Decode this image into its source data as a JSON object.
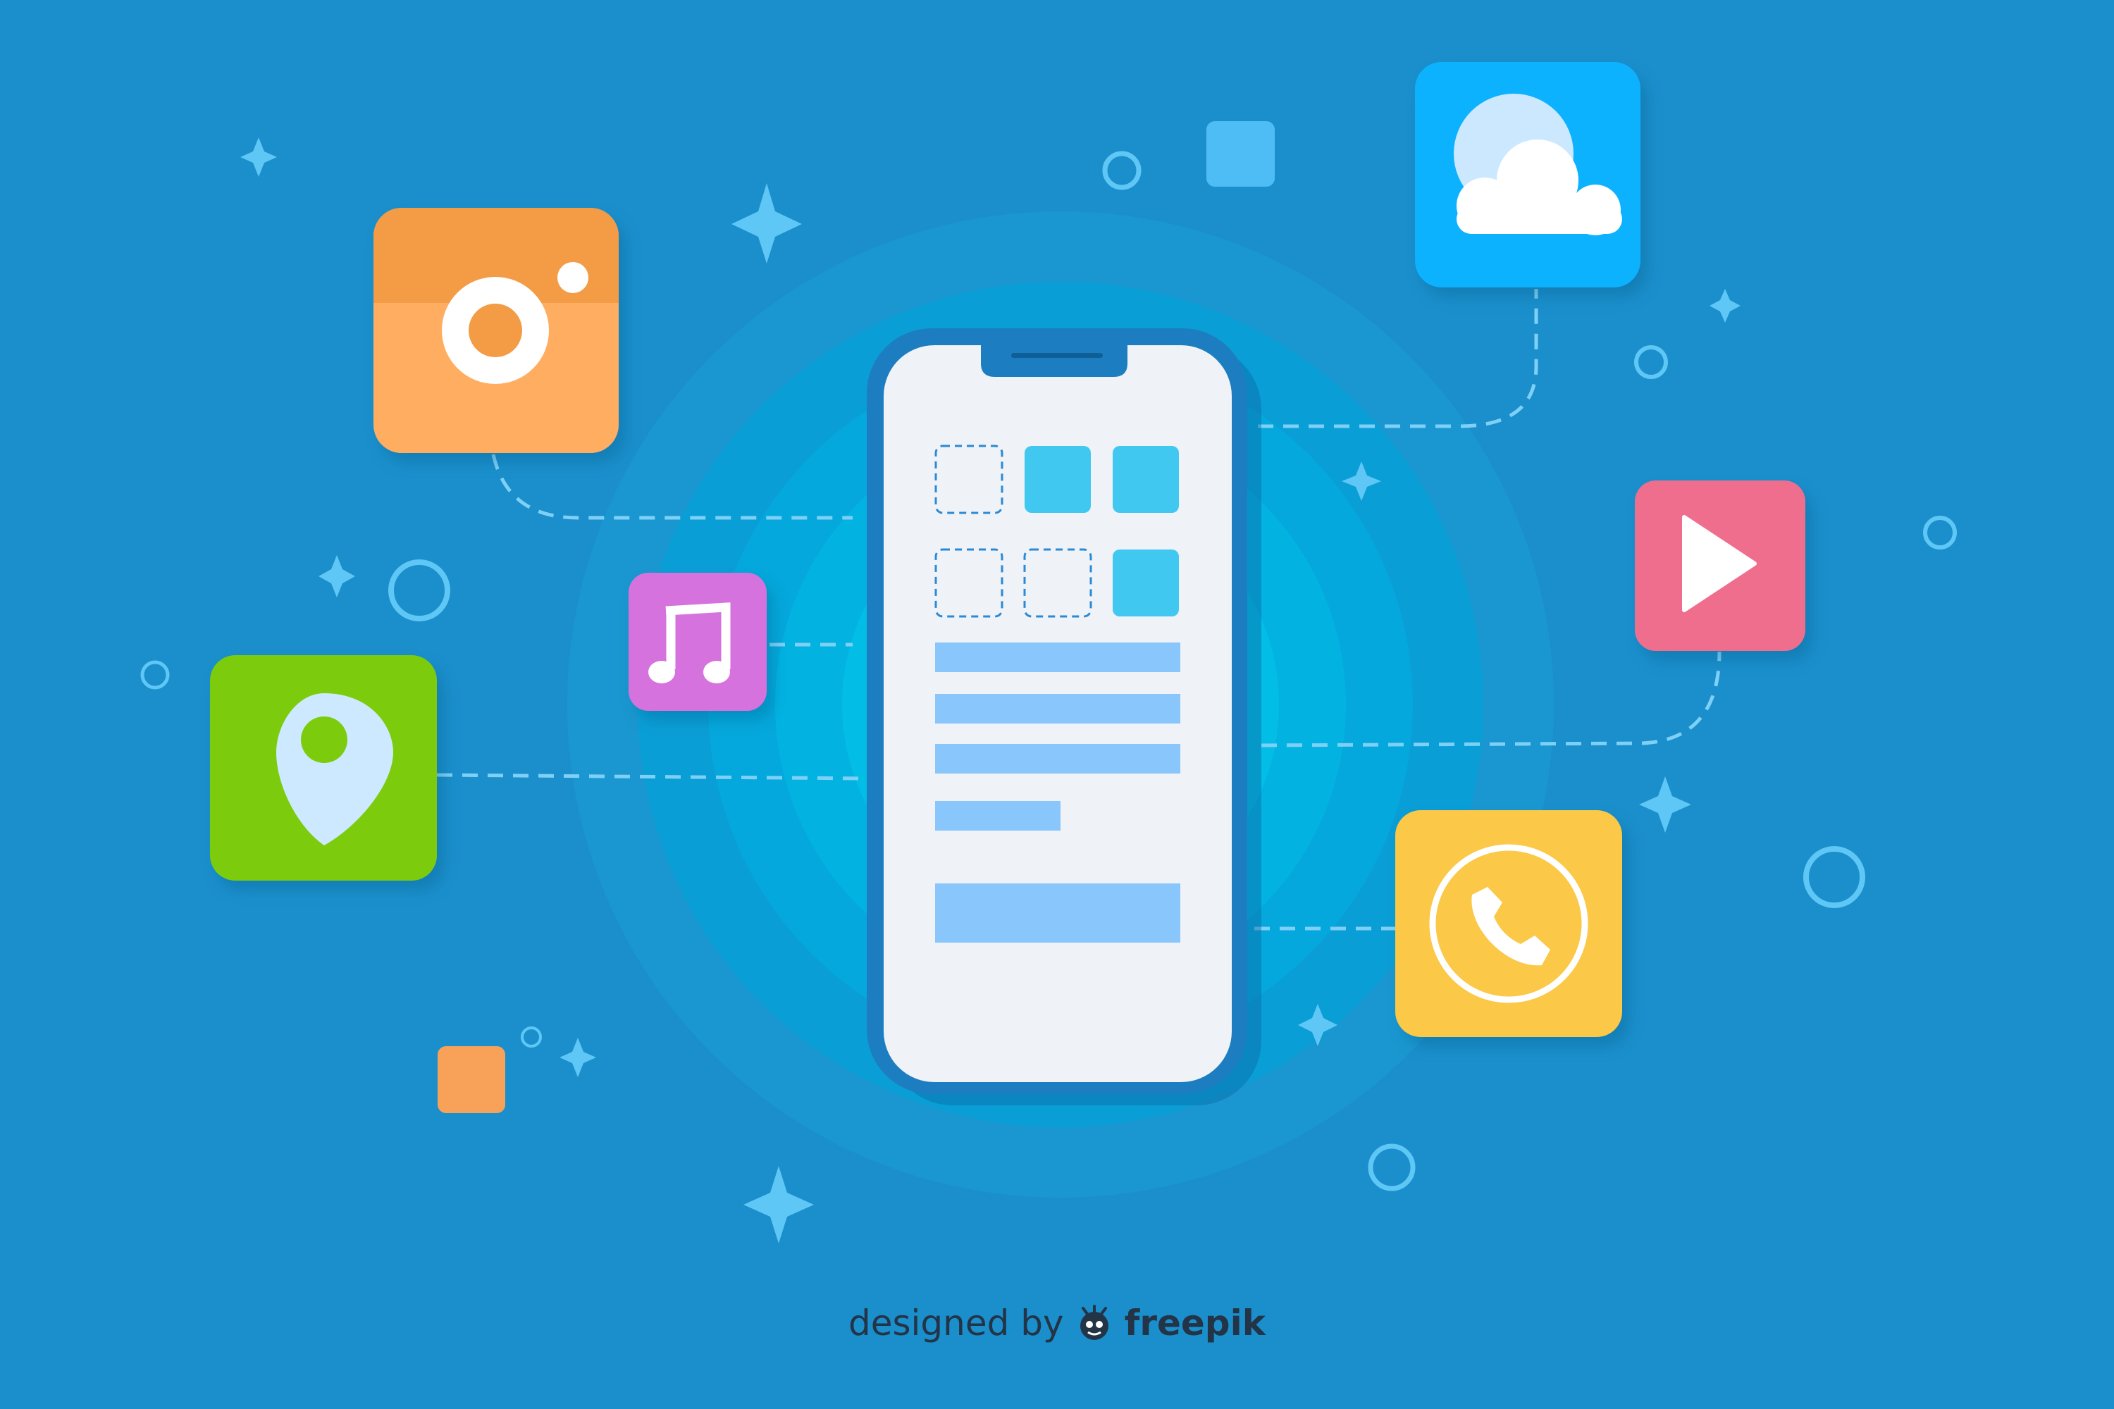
{
  "colors": {
    "background": "#1a8fcc",
    "camera_top": "#f49b45",
    "camera_bottom": "#ffad60",
    "location": "#7bcc0a",
    "music": "#d672dd",
    "cloud": "#0eb2ff",
    "video": "#f06e8d",
    "phone": "#fbc846",
    "phone_tile": "#41c8f1",
    "phone_line": "#89c6fb",
    "credit_text": "#243447"
  },
  "icons": [
    "camera-app-icon",
    "location-pin-app-icon",
    "music-note-app-icon",
    "cloud-app-icon",
    "video-play-app-icon",
    "phone-call-app-icon",
    "smartphone-illustration",
    "freepik-logo-icon"
  ],
  "credit": {
    "text": "designed by",
    "brand": "freepik"
  }
}
